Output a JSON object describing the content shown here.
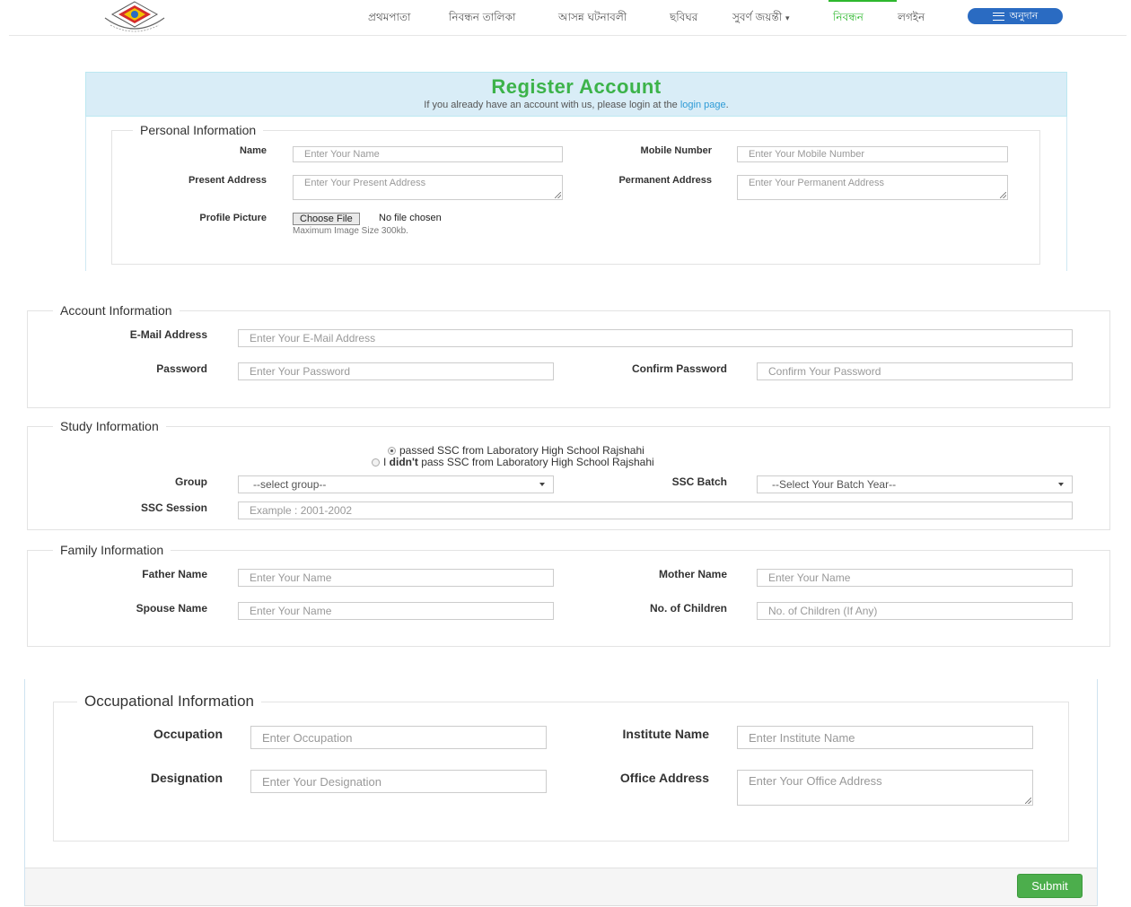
{
  "nav": {
    "logo_alt": "logo",
    "items": [
      "প্রথমপাতা",
      "নিবন্ধন তালিকা",
      "আসন্ন ঘটনাবলী",
      "ছবিঘর",
      "সুবর্ণ জয়ন্তী",
      "নিবন্ধন",
      "লগইন"
    ],
    "active_item": "নিবন্ধন",
    "donate_label": "অনুদান",
    "accent_color": "#2eb82e",
    "donate_color": "#2a6bc2"
  },
  "header": {
    "title": "Register Account",
    "subtitle_prefix": "If you already have an account with us, please login at the ",
    "subtitle_link": "login page",
    "subtitle_suffix": "."
  },
  "personal": {
    "legend": "Personal Information",
    "name_label": "Name",
    "name_placeholder": "Enter Your Name",
    "mobile_label": "Mobile Number",
    "mobile_placeholder": "Enter Your Mobile Number",
    "present_label": "Present Address",
    "present_placeholder": "Enter Your Present Address",
    "permanent_label": "Permanent Address",
    "permanent_placeholder": "Enter Your Permanent Address",
    "picture_label": "Profile Picture",
    "file_button": "Choose File",
    "file_status": "No file chosen",
    "file_hint": "Maximum Image Size 300kb."
  },
  "account": {
    "legend": "Account Information",
    "email_label": "E-Mail Address",
    "email_placeholder": "Enter Your E-Mail Address",
    "password_label": "Password",
    "password_placeholder": "Enter Your Password",
    "confirm_label": "Confirm Password",
    "confirm_placeholder": "Confirm Your Password"
  },
  "study": {
    "legend": "Study Information",
    "radio_passed": "passed SSC from Laboratory High School Rajshahi",
    "radio_not_prefix": "I ",
    "radio_not_bold": "didn't",
    "radio_not_suffix": " pass SSC from Laboratory High School Rajshahi",
    "group_label": "Group",
    "group_value": "--select group--",
    "batch_label": "SSC Batch",
    "batch_value": "--Select Your Batch Year--",
    "session_label": "SSC Session",
    "session_placeholder": "Example : 2001-2002"
  },
  "family": {
    "legend": "Family Information",
    "father_label": "Father Name",
    "father_placeholder": "Enter Your Name",
    "mother_label": "Mother Name",
    "mother_placeholder": "Enter Your Name",
    "spouse_label": "Spouse Name",
    "spouse_placeholder": "Enter Your Name",
    "children_label": "No. of Children",
    "children_placeholder": "No. of Children (If Any)"
  },
  "occupation": {
    "legend": "Occupational Information",
    "occupation_label": "Occupation",
    "occupation_placeholder": "Enter Occupation",
    "institute_label": "Institute Name",
    "institute_placeholder": "Enter Institute Name",
    "designation_label": "Designation",
    "designation_placeholder": "Enter Your Designation",
    "office_label": "Office Address",
    "office_placeholder": "Enter Your Office Address"
  },
  "submit_label": "Submit"
}
